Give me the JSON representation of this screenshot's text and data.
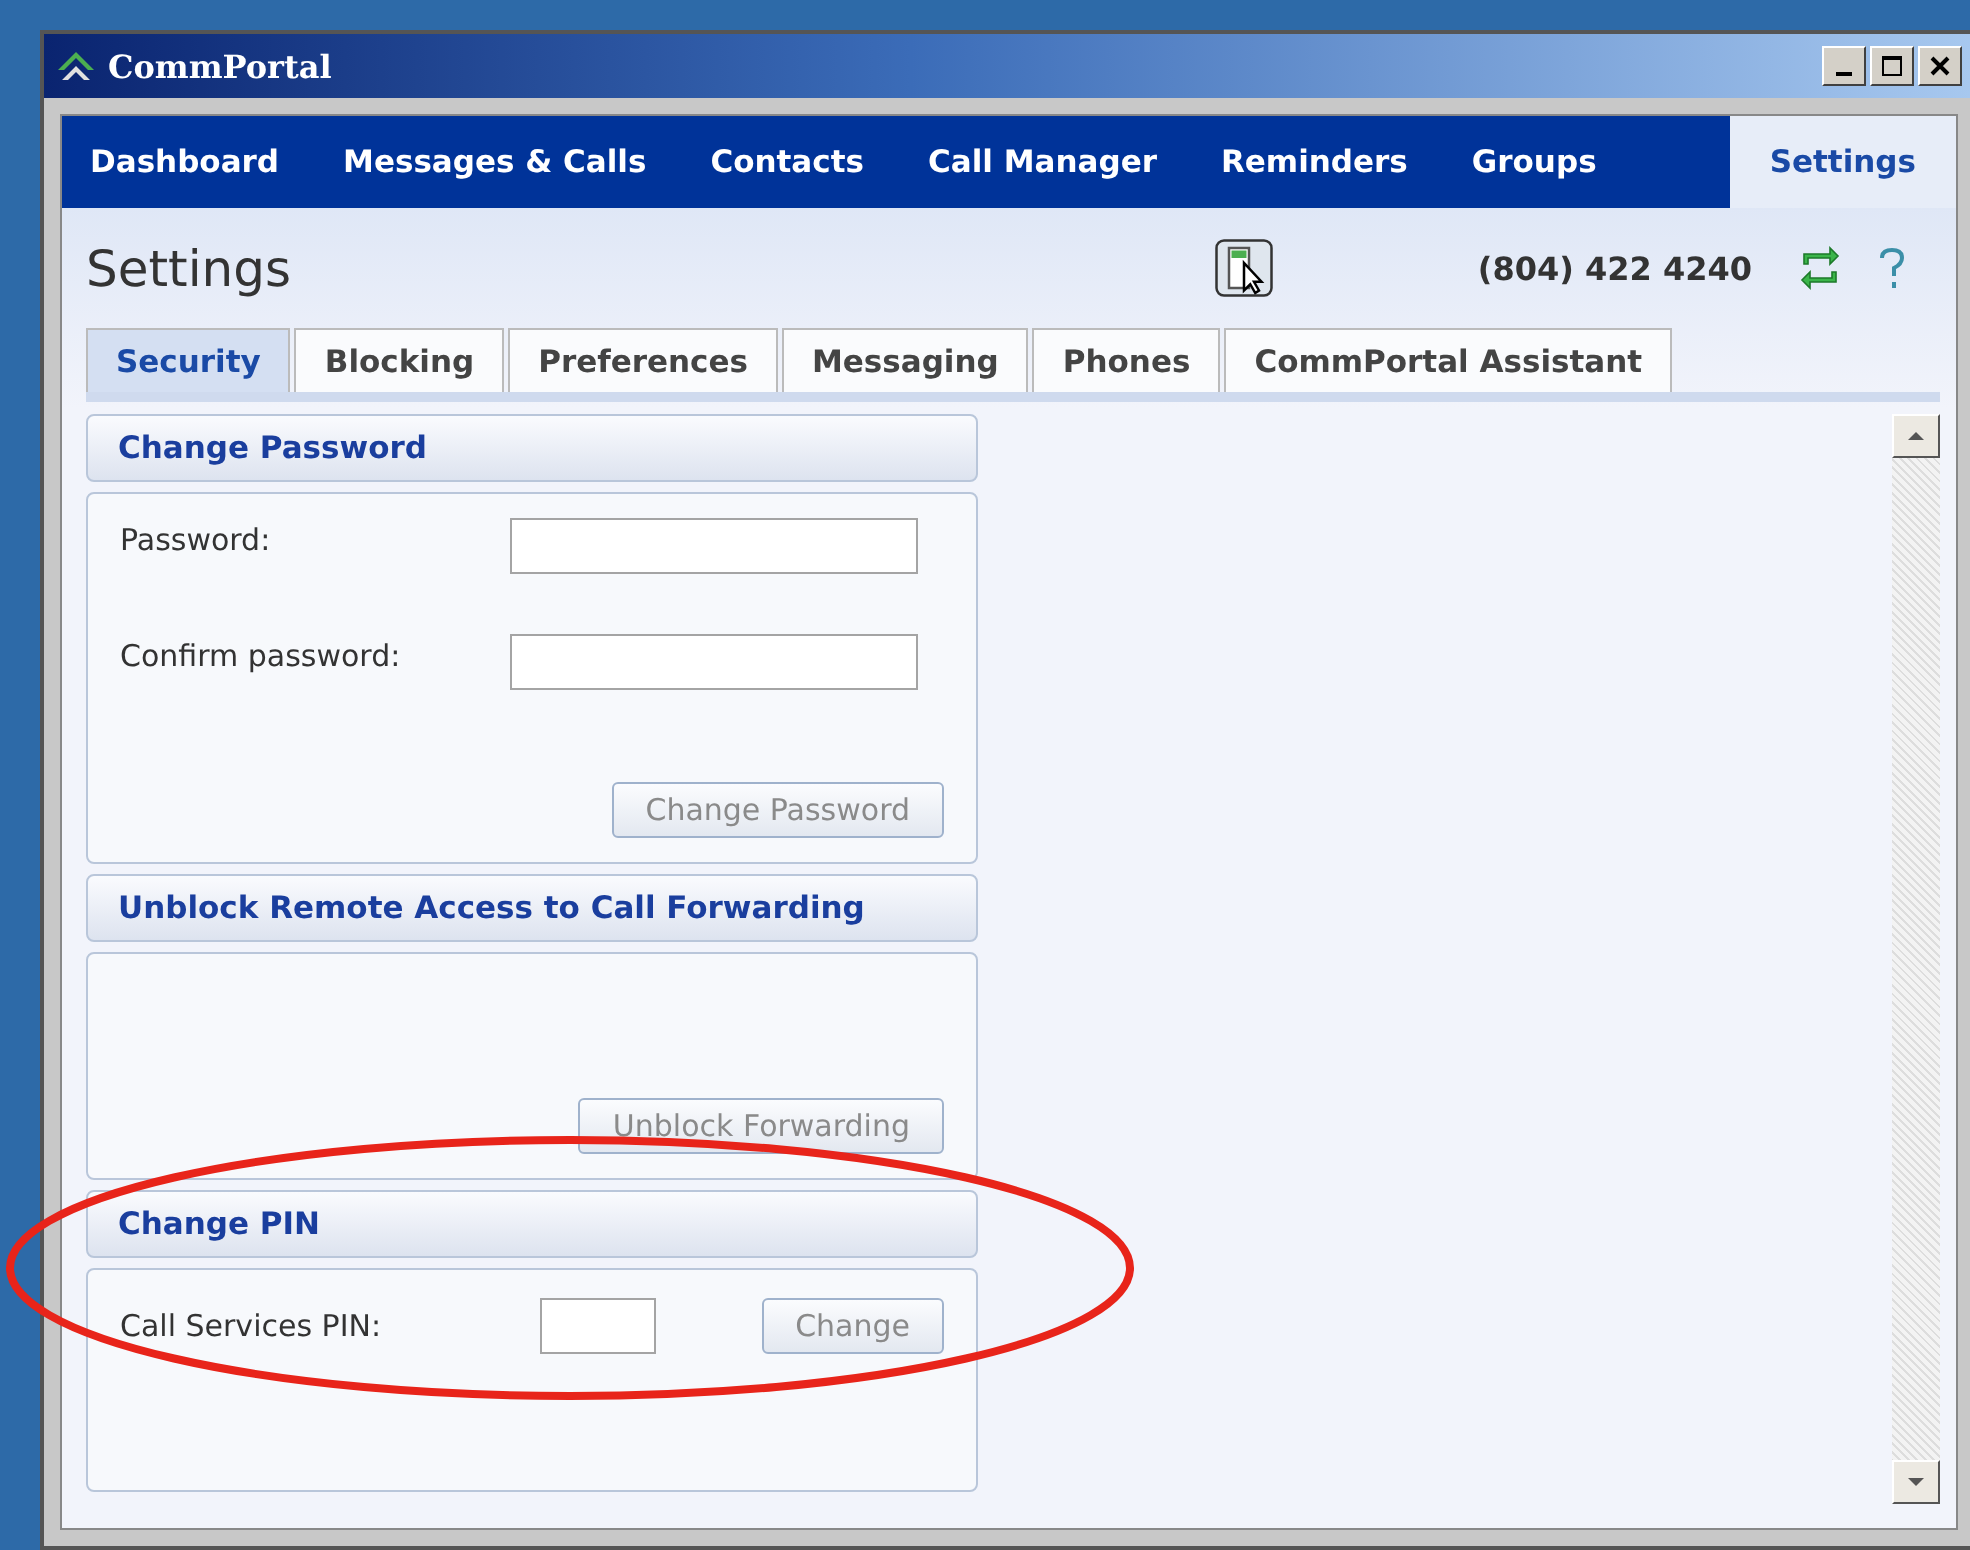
{
  "window": {
    "title": "CommPortal"
  },
  "nav_tabs": [
    {
      "label": "Dashboard",
      "selected": false
    },
    {
      "label": "Messages & Calls",
      "selected": false
    },
    {
      "label": "Contacts",
      "selected": false
    },
    {
      "label": "Call Manager",
      "selected": false
    },
    {
      "label": "Reminders",
      "selected": false
    },
    {
      "label": "Groups",
      "selected": false
    },
    {
      "label": "Settings",
      "selected": true
    }
  ],
  "page": {
    "title": "Settings",
    "phone_number": "(804) 422 4240"
  },
  "sub_tabs": [
    {
      "label": "Security",
      "selected": true
    },
    {
      "label": "Blocking",
      "selected": false
    },
    {
      "label": "Preferences",
      "selected": false
    },
    {
      "label": "Messaging",
      "selected": false
    },
    {
      "label": "Phones",
      "selected": false
    },
    {
      "label": "CommPortal Assistant",
      "selected": false
    }
  ],
  "sections": [
    {
      "kind": "form",
      "title": "Change Password",
      "fields": [
        {
          "label": "Password:"
        },
        {
          "label": "Confirm password:"
        }
      ],
      "button": {
        "label": "Change Password",
        "disabled": true
      }
    },
    {
      "kind": "button_only",
      "title": "Unblock Remote Access to Call Forwarding",
      "button": {
        "label": "Unblock Forwarding",
        "disabled": true
      }
    },
    {
      "kind": "inline",
      "title": "Change PIN",
      "fields": [
        {
          "label": "Call Services PIN:"
        }
      ],
      "button": {
        "label": "Change",
        "disabled": true
      }
    }
  ]
}
